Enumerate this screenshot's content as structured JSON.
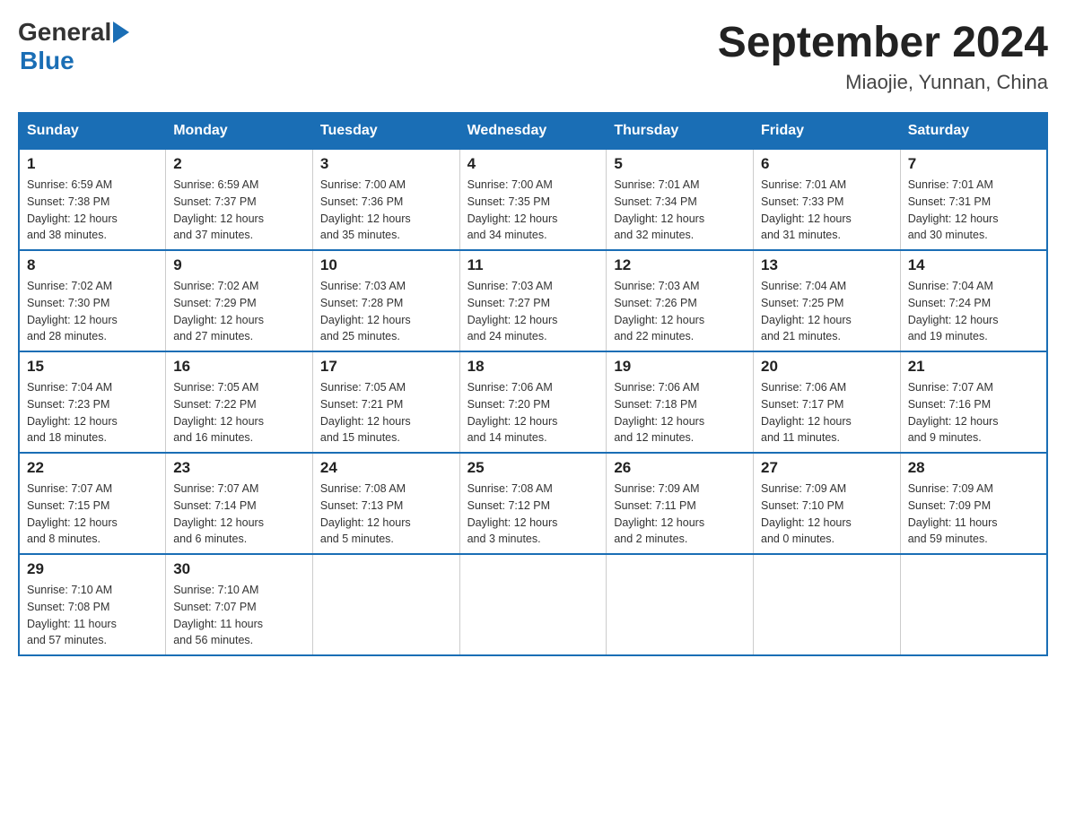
{
  "header": {
    "title": "September 2024",
    "subtitle": "Miaojie, Yunnan, China",
    "logo_general": "General",
    "logo_blue": "Blue"
  },
  "days_of_week": [
    "Sunday",
    "Monday",
    "Tuesday",
    "Wednesday",
    "Thursday",
    "Friday",
    "Saturday"
  ],
  "weeks": [
    [
      {
        "day": "1",
        "sunrise": "6:59 AM",
        "sunset": "7:38 PM",
        "daylight": "12 hours and 38 minutes."
      },
      {
        "day": "2",
        "sunrise": "6:59 AM",
        "sunset": "7:37 PM",
        "daylight": "12 hours and 37 minutes."
      },
      {
        "day": "3",
        "sunrise": "7:00 AM",
        "sunset": "7:36 PM",
        "daylight": "12 hours and 35 minutes."
      },
      {
        "day": "4",
        "sunrise": "7:00 AM",
        "sunset": "7:35 PM",
        "daylight": "12 hours and 34 minutes."
      },
      {
        "day": "5",
        "sunrise": "7:01 AM",
        "sunset": "7:34 PM",
        "daylight": "12 hours and 32 minutes."
      },
      {
        "day": "6",
        "sunrise": "7:01 AM",
        "sunset": "7:33 PM",
        "daylight": "12 hours and 31 minutes."
      },
      {
        "day": "7",
        "sunrise": "7:01 AM",
        "sunset": "7:31 PM",
        "daylight": "12 hours and 30 minutes."
      }
    ],
    [
      {
        "day": "8",
        "sunrise": "7:02 AM",
        "sunset": "7:30 PM",
        "daylight": "12 hours and 28 minutes."
      },
      {
        "day": "9",
        "sunrise": "7:02 AM",
        "sunset": "7:29 PM",
        "daylight": "12 hours and 27 minutes."
      },
      {
        "day": "10",
        "sunrise": "7:03 AM",
        "sunset": "7:28 PM",
        "daylight": "12 hours and 25 minutes."
      },
      {
        "day": "11",
        "sunrise": "7:03 AM",
        "sunset": "7:27 PM",
        "daylight": "12 hours and 24 minutes."
      },
      {
        "day": "12",
        "sunrise": "7:03 AM",
        "sunset": "7:26 PM",
        "daylight": "12 hours and 22 minutes."
      },
      {
        "day": "13",
        "sunrise": "7:04 AM",
        "sunset": "7:25 PM",
        "daylight": "12 hours and 21 minutes."
      },
      {
        "day": "14",
        "sunrise": "7:04 AM",
        "sunset": "7:24 PM",
        "daylight": "12 hours and 19 minutes."
      }
    ],
    [
      {
        "day": "15",
        "sunrise": "7:04 AM",
        "sunset": "7:23 PM",
        "daylight": "12 hours and 18 minutes."
      },
      {
        "day": "16",
        "sunrise": "7:05 AM",
        "sunset": "7:22 PM",
        "daylight": "12 hours and 16 minutes."
      },
      {
        "day": "17",
        "sunrise": "7:05 AM",
        "sunset": "7:21 PM",
        "daylight": "12 hours and 15 minutes."
      },
      {
        "day": "18",
        "sunrise": "7:06 AM",
        "sunset": "7:20 PM",
        "daylight": "12 hours and 14 minutes."
      },
      {
        "day": "19",
        "sunrise": "7:06 AM",
        "sunset": "7:18 PM",
        "daylight": "12 hours and 12 minutes."
      },
      {
        "day": "20",
        "sunrise": "7:06 AM",
        "sunset": "7:17 PM",
        "daylight": "12 hours and 11 minutes."
      },
      {
        "day": "21",
        "sunrise": "7:07 AM",
        "sunset": "7:16 PM",
        "daylight": "12 hours and 9 minutes."
      }
    ],
    [
      {
        "day": "22",
        "sunrise": "7:07 AM",
        "sunset": "7:15 PM",
        "daylight": "12 hours and 8 minutes."
      },
      {
        "day": "23",
        "sunrise": "7:07 AM",
        "sunset": "7:14 PM",
        "daylight": "12 hours and 6 minutes."
      },
      {
        "day": "24",
        "sunrise": "7:08 AM",
        "sunset": "7:13 PM",
        "daylight": "12 hours and 5 minutes."
      },
      {
        "day": "25",
        "sunrise": "7:08 AM",
        "sunset": "7:12 PM",
        "daylight": "12 hours and 3 minutes."
      },
      {
        "day": "26",
        "sunrise": "7:09 AM",
        "sunset": "7:11 PM",
        "daylight": "12 hours and 2 minutes."
      },
      {
        "day": "27",
        "sunrise": "7:09 AM",
        "sunset": "7:10 PM",
        "daylight": "12 hours and 0 minutes."
      },
      {
        "day": "28",
        "sunrise": "7:09 AM",
        "sunset": "7:09 PM",
        "daylight": "11 hours and 59 minutes."
      }
    ],
    [
      {
        "day": "29",
        "sunrise": "7:10 AM",
        "sunset": "7:08 PM",
        "daylight": "11 hours and 57 minutes."
      },
      {
        "day": "30",
        "sunrise": "7:10 AM",
        "sunset": "7:07 PM",
        "daylight": "11 hours and 56 minutes."
      },
      null,
      null,
      null,
      null,
      null
    ]
  ]
}
